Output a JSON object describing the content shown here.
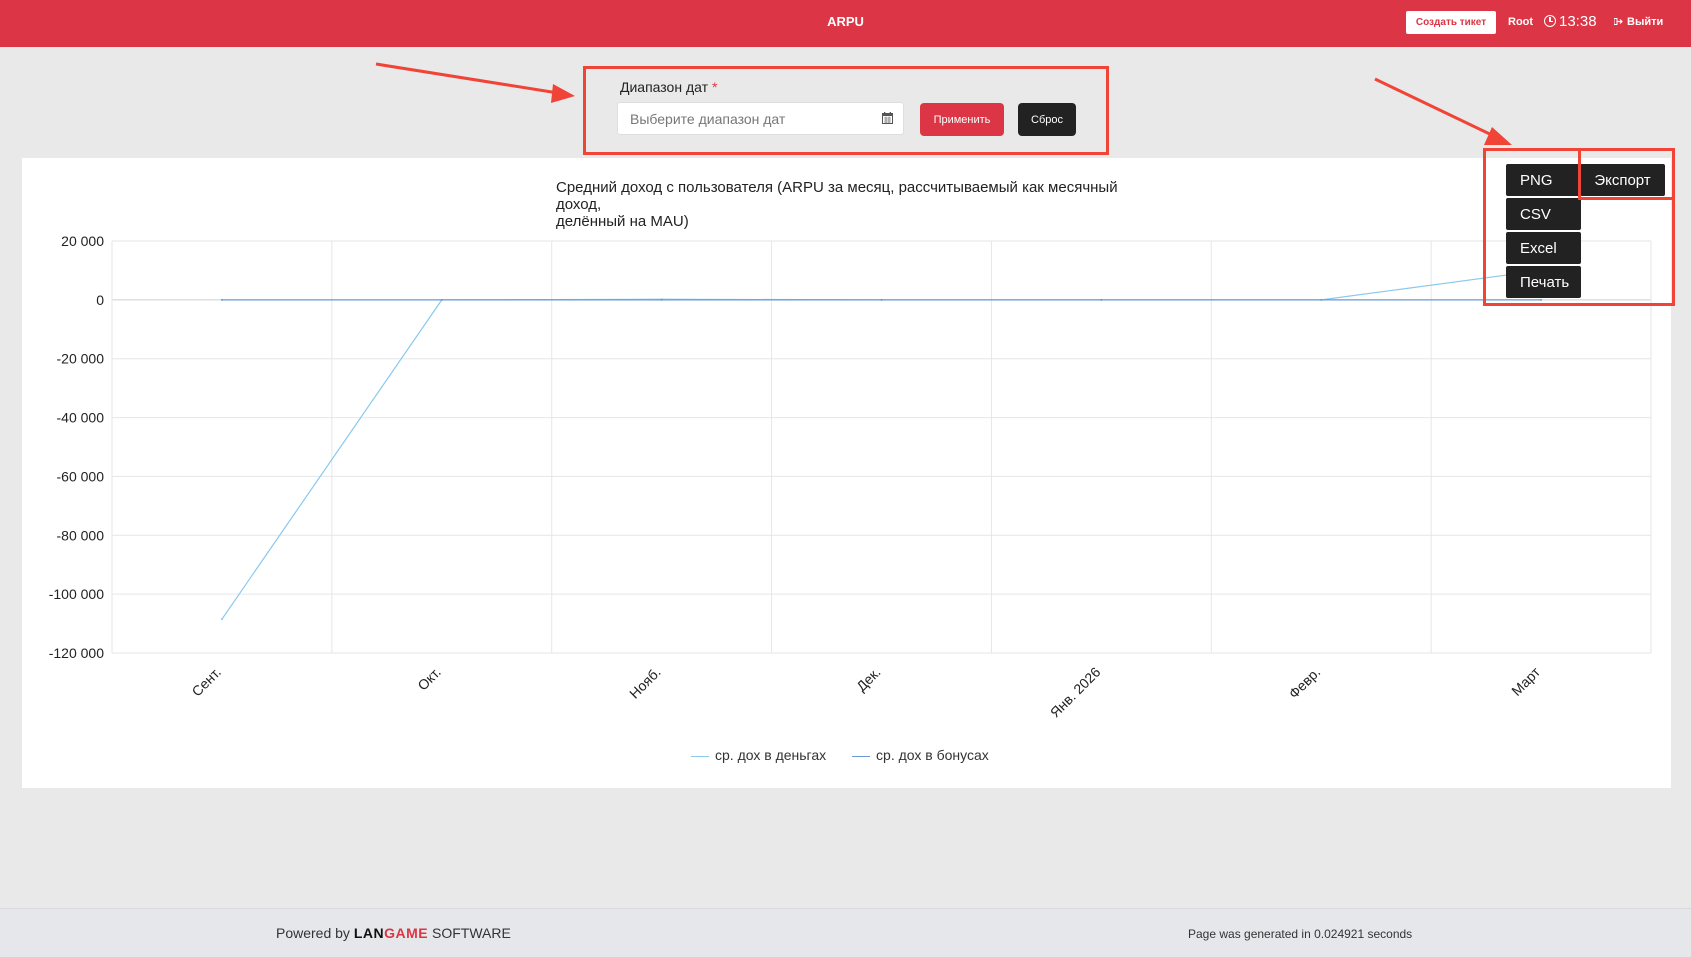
{
  "header": {
    "title": "ARPU",
    "create_ticket_label": "Создать тикет",
    "user": "Root",
    "time": "13:38",
    "logout_label": "Выйти"
  },
  "filter": {
    "label": "Диапазон дат",
    "required_mark": "*",
    "date_placeholder": "Выберите диапазон дат",
    "apply_label": "Применить",
    "reset_label": "Сброс"
  },
  "export_menu": {
    "button_label": "Экспорт",
    "items": [
      "PNG",
      "CSV",
      "Excel",
      "Печать"
    ]
  },
  "chart_data": {
    "type": "line",
    "title": "Средний доход с пользователя (ARPU за месяц, рассчитываемый как месячный доход, делённый на MAU)",
    "title_line1": "Средний доход с пользователя (ARPU за месяц, рассчитываемый как месячный доход,",
    "title_line2": "делённый на MAU)",
    "categories": [
      "Сент.",
      "Окт.",
      "Нояб.",
      "Дек.",
      "Янв. 2026",
      "Февр.",
      "Март"
    ],
    "ylim": [
      -120000,
      20000
    ],
    "yticks": [
      20000,
      0,
      -20000,
      -40000,
      -60000,
      -80000,
      -100000,
      -120000
    ],
    "ytick_labels": [
      "20 000",
      "0",
      "-20 000",
      "-40 000",
      "-60 000",
      "-80 000",
      "-100 000",
      "-120 000"
    ],
    "grid": true,
    "legend_position": "bottom",
    "series": [
      {
        "name": "ср. дох в деньгах",
        "color": "#8ac8ee",
        "values": [
          -108500,
          0,
          200,
          0,
          0,
          0,
          10000
        ]
      },
      {
        "name": "ср. дох в бонусах",
        "color": "#6a9bd6",
        "values": [
          0,
          0,
          0,
          0,
          0,
          0,
          0
        ]
      }
    ]
  },
  "footer": {
    "powered_prefix": "Powered by",
    "brand_lan": "LAN",
    "brand_game": "GAME",
    "brand_suffix": "SOFTWARE",
    "generated": "Page was generated in 0.024921 seconds"
  },
  "colors": {
    "header_bg": "#dc3545",
    "annotation": "#f04437",
    "dark_button": "#222222"
  }
}
